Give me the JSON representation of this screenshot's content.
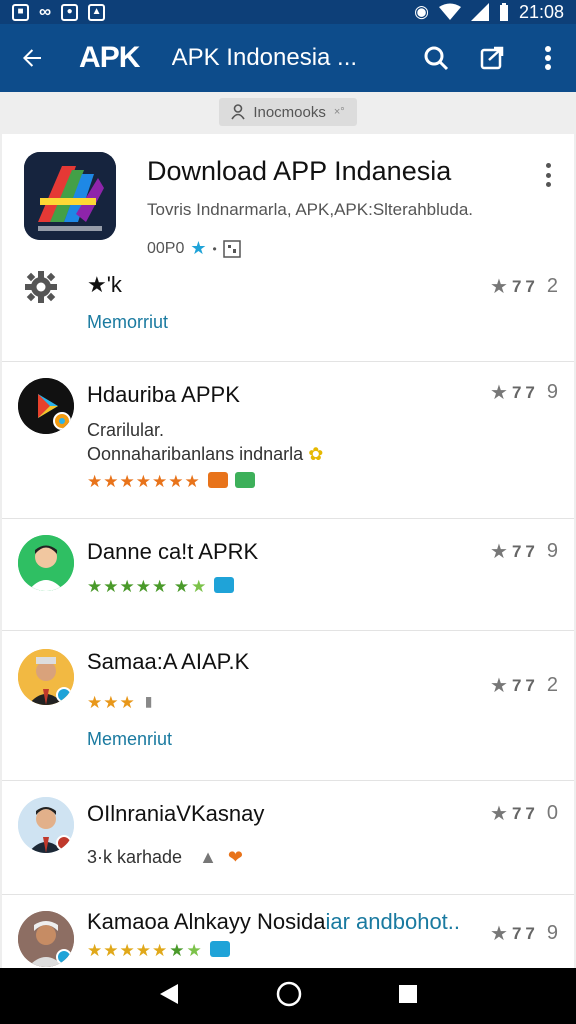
{
  "status_bar": {
    "time": "21:08"
  },
  "app_bar": {
    "logo": "APK",
    "title": "APK Indonesia ..."
  },
  "chip": {
    "label": "Inocmooks",
    "extra": "×°"
  },
  "app_header": {
    "name": "Download APP Indanesia",
    "subtitle": "Tovris Indnarmarla, APK,APK:Slterahbluda.",
    "meta": "00P0"
  },
  "summary_row": {
    "label": "★'k",
    "link": "Memorriut",
    "rating": "7",
    "count": "2"
  },
  "reviews": [
    {
      "title": "Hdauriba APPK",
      "line1": "Crarilular.",
      "line2": "Oonnaharibanlans indnarla",
      "rating": "7",
      "count": "9"
    },
    {
      "title": "Danne ca!t APRK",
      "rating": "7",
      "count": "9"
    },
    {
      "title": "Samaa:A AIAP.K",
      "link": "Memenriut",
      "rating": "7",
      "count": "2"
    },
    {
      "title": "OIlnraniaVKasnay",
      "line1": "3·k karhade",
      "rating": "7",
      "count": "0"
    },
    {
      "title": "Kamaoa Alnkayy Nosida",
      "title_link": "iar andbohot..",
      "rating": "7",
      "count": "9"
    }
  ],
  "colors": {
    "app_bar": "#0d4c8b",
    "status_bar": "#0d3f78",
    "link": "#1a7aa0",
    "star_orange": "#e8731a",
    "star_green": "#4a9a2a"
  }
}
